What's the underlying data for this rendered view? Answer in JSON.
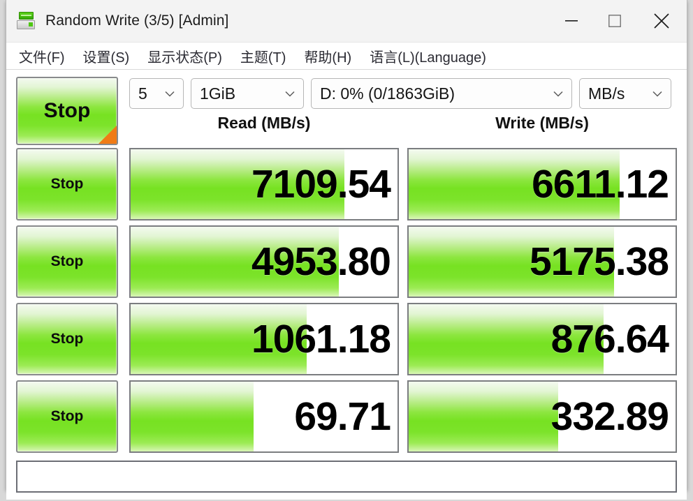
{
  "window": {
    "title": "Random Write (3/5) [Admin]",
    "icon": "disk-drive-icon",
    "minimize": "minimize-icon",
    "maximize": "maximize-icon",
    "close": "close-icon"
  },
  "menu": {
    "items": [
      {
        "label": "文件(F)"
      },
      {
        "label": "设置(S)"
      },
      {
        "label": "显示状态(P)"
      },
      {
        "label": "主题(T)"
      },
      {
        "label": "帮助(H)"
      },
      {
        "label": "语言(L)(Language)"
      }
    ]
  },
  "toolbar": {
    "count": "5",
    "size": "1GiB",
    "drive": "D: 0% (0/1863GiB)",
    "unit": "MB/s",
    "arrow": "chevron-down-icon"
  },
  "headers": {
    "read": "Read (MB/s)",
    "write": "Write (MB/s)"
  },
  "buttons": {
    "all": "Stop",
    "row1": "Stop",
    "row2": "Stop",
    "row3": "Stop",
    "row4": "Stop"
  },
  "results": {
    "rows": [
      {
        "read": "7109.54",
        "write": "6611.12",
        "read_fill": 80,
        "write_fill": 79
      },
      {
        "read": "4953.80",
        "write": "5175.38",
        "read_fill": 78,
        "write_fill": 77
      },
      {
        "read": "1061.18",
        "write": "876.64",
        "read_fill": 66,
        "write_fill": 73
      },
      {
        "read": "69.71",
        "write": "332.89",
        "read_fill": 46,
        "write_fill": 56
      }
    ]
  },
  "comment": {
    "value": "",
    "placeholder": ""
  },
  "colors": {
    "green_mid": "#77e222",
    "green_light": "#d9f6b6",
    "orange_corner": "#f07b16",
    "border": "#7b7d80"
  }
}
